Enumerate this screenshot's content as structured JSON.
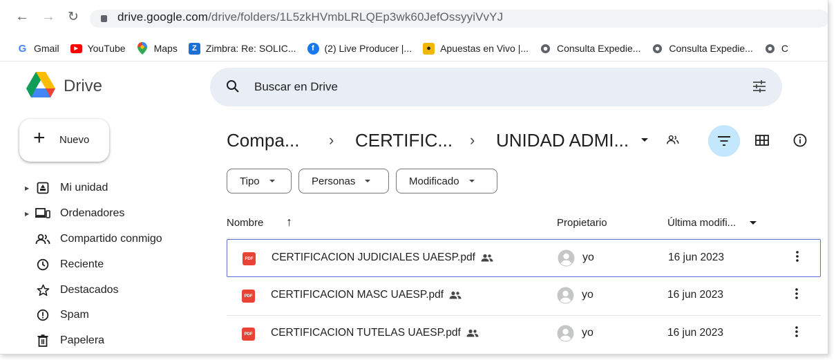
{
  "browser": {
    "url_host": "drive.google.com",
    "url_path": "/drive/folders/1L5zkHVmbLRLQEp3wk60JefOssyyiVvYJ"
  },
  "bookmarks": [
    {
      "label": "Gmail",
      "icon": "gmail-icon"
    },
    {
      "label": "YouTube",
      "icon": "youtube-icon"
    },
    {
      "label": "Maps",
      "icon": "maps-icon"
    },
    {
      "label": "Zimbra: Re: SOLIC...",
      "icon": "zimbra-icon"
    },
    {
      "label": "(2) Live Producer |...",
      "icon": "facebook-icon"
    },
    {
      "label": "Apuestas en Vivo |...",
      "icon": "betting-icon"
    },
    {
      "label": "Consulta Expedie...",
      "icon": "globe-icon"
    },
    {
      "label": "Consulta Expedie...",
      "icon": "globe-icon"
    },
    {
      "label": "C",
      "icon": "globe-icon"
    }
  ],
  "app": {
    "title": "Drive"
  },
  "sidebar": {
    "new_label": "Nuevo",
    "items": [
      {
        "label": "Mi unidad",
        "icon": "my-drive-icon"
      },
      {
        "label": "Ordenadores",
        "icon": "computers-icon"
      },
      {
        "label": "Compartido conmigo",
        "icon": "shared-with-me-icon"
      },
      {
        "label": "Reciente",
        "icon": "clock-icon"
      },
      {
        "label": "Destacados",
        "icon": "star-icon"
      },
      {
        "label": "Spam",
        "icon": "spam-icon"
      },
      {
        "label": "Papelera",
        "icon": "trash-icon"
      }
    ]
  },
  "search": {
    "placeholder": "Buscar en Drive"
  },
  "breadcrumb": [
    "Compa...",
    "CERTIFIC...",
    "UNIDAD ADMI..."
  ],
  "chips": [
    "Tipo",
    "Personas",
    "Modificado"
  ],
  "columns": {
    "name": "Nombre",
    "owner": "Propietario",
    "modified": "Última modifi..."
  },
  "files": [
    {
      "name": "CERTIFICACION JUDICIALES UAESP.pdf",
      "owner": "yo",
      "modified": "16 jun 2023",
      "selected": true
    },
    {
      "name": "CERTIFICACION MASC UAESP.pdf",
      "owner": "yo",
      "modified": "16 jun 2023",
      "selected": false
    },
    {
      "name": "CERTIFICACION TUTELAS UAESP.pdf",
      "owner": "yo",
      "modified": "16 jun 2023",
      "selected": false
    }
  ],
  "colors": {
    "accent": "#c2e7ff",
    "search_bg": "#e9eef6",
    "pdf": "#ea4335",
    "selection": "#5b6fd6"
  }
}
